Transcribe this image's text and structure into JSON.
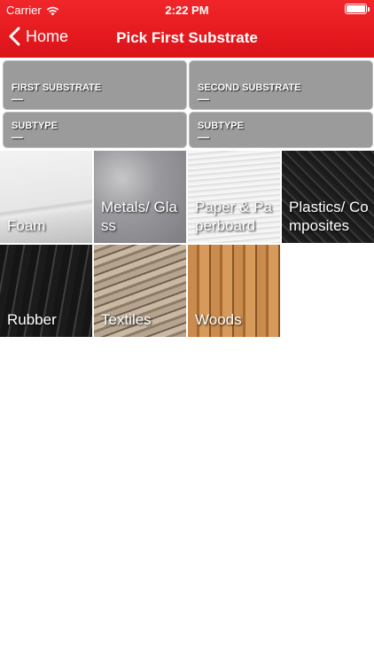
{
  "status_bar": {
    "carrier": "Carrier",
    "time": "2:22 PM"
  },
  "nav": {
    "back_label": "Home",
    "title": "Pick First Substrate"
  },
  "selection": {
    "first_substrate_label": "FIRST SUBSTRATE",
    "first_substrate_value": "—",
    "second_substrate_label": "SECOND SUBSTRATE",
    "second_substrate_value": "—",
    "first_subtype_label": "SUBTYPE",
    "first_subtype_value": "—",
    "second_subtype_label": "SUBTYPE",
    "second_subtype_value": "—"
  },
  "substrates": [
    {
      "label": "Foam"
    },
    {
      "label": "Metals/ Glass"
    },
    {
      "label": "Paper & Paperboard"
    },
    {
      "label": "Plastics/ Composites"
    },
    {
      "label": "Rubber"
    },
    {
      "label": "Textiles"
    },
    {
      "label": "Woods"
    }
  ],
  "colors": {
    "header_red": "#e51a1f",
    "selection_box_gray": "#9b9b9b"
  }
}
